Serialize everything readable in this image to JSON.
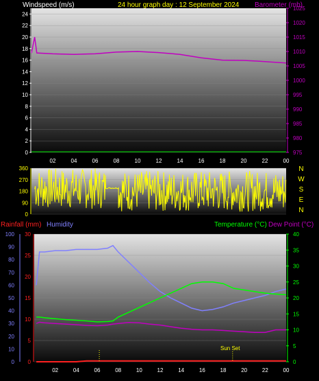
{
  "header": {
    "left": "Windspeed (m/s)",
    "center": "24 hour graph day : 12 September 2024",
    "right": "Barometer (mb)"
  },
  "colors": {
    "windspeed": "#ffffff",
    "barometer": "#c000c0",
    "title": "#ffff00",
    "rainfall": "#ff2020",
    "humidity": "#8080ff",
    "temperature": "#00ff00",
    "dewpoint": "#c000c0",
    "winddir": "#ffff00",
    "gridline": "#888888",
    "bg": "#000000"
  },
  "compass": [
    "N",
    "W",
    "S",
    "E",
    "N"
  ],
  "bottom_header": {
    "rainfall": "Rainfall (mm)",
    "humidity": "Humidity",
    "temperature": "Temperature (°C)",
    "dewpoint": "Dew Point (°C)"
  },
  "sunset_label": "Sun Set",
  "x_ticks": [
    "02",
    "04",
    "06",
    "08",
    "10",
    "12",
    "14",
    "16",
    "18",
    "20",
    "22",
    "00"
  ],
  "chart_data": [
    {
      "type": "line",
      "title": "24 hour graph day : 12 September 2024",
      "x_hours": [
        0,
        0.3,
        0.5,
        2,
        4,
        6,
        8,
        10,
        12,
        14,
        16,
        18,
        20,
        22,
        24
      ],
      "series": [
        {
          "name": "Windspeed (m/s)",
          "axis": "left",
          "values": [
            0.1,
            0.1,
            0.1,
            0.1,
            0.1,
            0.1,
            0.1,
            0.1,
            0.1,
            0.1,
            0.1,
            0.1,
            0.1,
            0.1,
            0.1
          ]
        },
        {
          "name": "Barometer (mb)",
          "axis": "right",
          "values": [
            1009.5,
            1015,
            1009.5,
            1009.2,
            1009.0,
            1009.2,
            1009.8,
            1010.0,
            1009.6,
            1009.0,
            1007.8,
            1007.0,
            1006.9,
            1006.5,
            1006.0
          ]
        }
      ],
      "left_ticks": [
        0,
        2,
        4,
        6,
        8,
        10,
        12,
        14,
        16,
        18,
        20,
        22,
        24
      ],
      "right_ticks": [
        975,
        980,
        985,
        990,
        995,
        1000,
        1005,
        1010,
        1015,
        1020,
        1025
      ],
      "ylim_left": [
        0,
        25
      ],
      "ylim_right": [
        975,
        1025
      ]
    },
    {
      "type": "scatter",
      "series_name": "Wind direction",
      "left_ticks": [
        0,
        90,
        180,
        270,
        360
      ],
      "ylim": [
        0,
        360
      ],
      "segments": [
        {
          "from": 0.3,
          "to": 7.0,
          "min": 40,
          "max": 360
        },
        {
          "from": 7.0,
          "to": 8.2,
          "min": 200,
          "max": 210
        },
        {
          "from": 8.2,
          "to": 24.0,
          "min": 20,
          "max": 340
        }
      ]
    },
    {
      "type": "line",
      "x_hours": [
        0.2,
        0.5,
        1,
        2,
        3,
        4,
        5,
        6,
        7,
        7.5,
        8,
        9,
        10,
        11,
        12,
        13,
        14,
        15,
        16,
        17,
        18,
        19,
        20,
        21,
        22,
        23,
        24
      ],
      "series": [
        {
          "name": "Humidity",
          "axis": "left_pct",
          "values": [
            60,
            86,
            86,
            87,
            87,
            88,
            88,
            88,
            89,
            91,
            86,
            78,
            70,
            62,
            55,
            50,
            46,
            42,
            40,
            41,
            43,
            46,
            48,
            50,
            52,
            55,
            57
          ]
        },
        {
          "name": "Temperature (°C)",
          "axis": "right_c",
          "values": [
            14,
            14,
            13.8,
            13.5,
            13.2,
            13,
            12.8,
            12.5,
            12.6,
            12.8,
            14,
            15.5,
            17,
            18.5,
            20,
            21.5,
            23,
            24.5,
            25,
            25,
            24.5,
            23,
            22.5,
            22,
            21.5,
            21.2,
            21
          ]
        },
        {
          "name": "Dew Point (°C)",
          "axis": "right_c",
          "values": [
            12,
            12.4,
            12.2,
            12,
            11.8,
            11.6,
            11.4,
            11.3,
            11.5,
            11.8,
            12,
            12.3,
            12.2,
            11.8,
            11.5,
            11,
            10.5,
            10.2,
            10,
            10,
            9.8,
            9.6,
            9.4,
            9.2,
            9.2,
            10,
            10
          ]
        },
        {
          "name": "Rainfall (mm)",
          "axis": "left_rain",
          "values": [
            0,
            0,
            0,
            0,
            0,
            0,
            0.2,
            0.2,
            0.2,
            0.2,
            0.2,
            0.2,
            0.2,
            0.2,
            0.2,
            0.2,
            0.2,
            0.2,
            0.2,
            0.2,
            0.2,
            0.2,
            0.2,
            0.2,
            0.2,
            0.2,
            0.2
          ]
        }
      ],
      "humidity_ticks": [
        0,
        10,
        20,
        30,
        40,
        50,
        60,
        70,
        80,
        90,
        100
      ],
      "rain_ticks": [
        0,
        5,
        10,
        15,
        20,
        25,
        30
      ],
      "temp_ticks": [
        0,
        5,
        10,
        15,
        20,
        25,
        30,
        35,
        40
      ],
      "ylim_humidity": [
        0,
        100
      ],
      "ylim_rain": [
        0,
        30
      ],
      "ylim_temp": [
        0,
        40
      ],
      "sunset_hour": 18.9,
      "marker_hour": 6.2
    }
  ]
}
